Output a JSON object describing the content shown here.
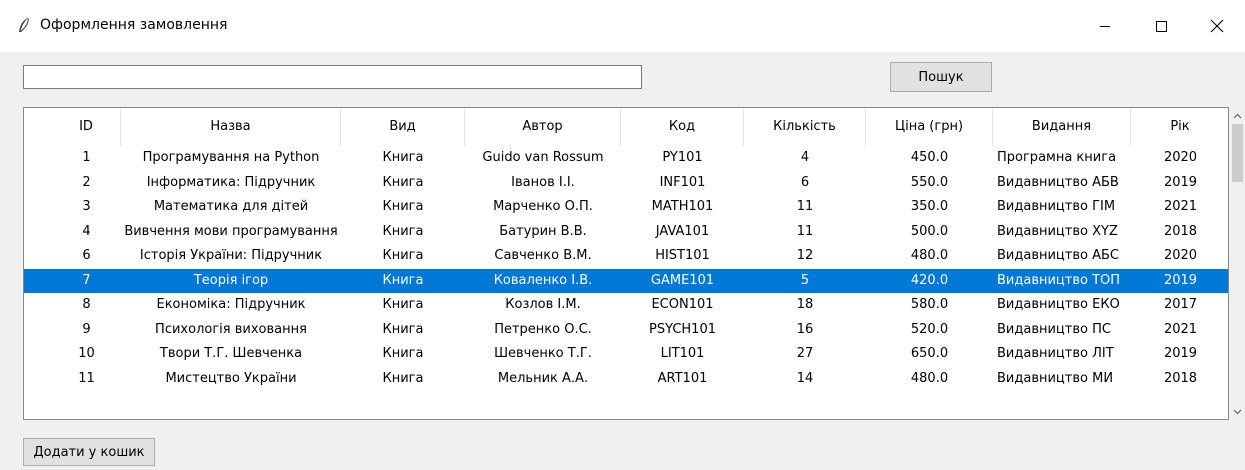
{
  "window": {
    "title": "Оформлення замовлення",
    "app_icon": "feather-icon",
    "controls": [
      "minimize-icon",
      "maximize-icon",
      "close-icon"
    ]
  },
  "search": {
    "value": "",
    "placeholder": "",
    "button_label": "Пошук"
  },
  "table": {
    "columns": [
      "ID",
      "Назва",
      "Вид",
      "Автор",
      "Код",
      "Кількість",
      "Ціна (грн)",
      "Видання",
      "Рік"
    ],
    "rows": [
      [
        "1",
        "Програмування на Python",
        "Книга",
        "Guido van Rossum",
        "PY101",
        "4",
        "450.0",
        "Програмна книга",
        "2020"
      ],
      [
        "2",
        "Інформатика: Підручник",
        "Книга",
        "Іванов І.І.",
        "INF101",
        "6",
        "550.0",
        "Видавництво АБВ",
        "2019"
      ],
      [
        "3",
        "Математика для дітей",
        "Книга",
        "Марченко О.П.",
        "MATH101",
        "11",
        "350.0",
        "Видавництво ГІМ",
        "2021"
      ],
      [
        "4",
        "Вивчення мови програмування",
        "Книга",
        "Батурин В.В.",
        "JAVA101",
        "11",
        "500.0",
        "Видавництво XYZ",
        "2018"
      ],
      [
        "6",
        "Історія України: Підручник",
        "Книга",
        "Савченко В.М.",
        "HIST101",
        "12",
        "480.0",
        "Видавництво АБС",
        "2020"
      ],
      [
        "7",
        "Теорія ігор",
        "Книга",
        "Коваленко І.В.",
        "GAME101",
        "5",
        "420.0",
        "Видавництво ТОП",
        "2019"
      ],
      [
        "8",
        "Економіка: Підручник",
        "Книга",
        "Козлов І.М.",
        "ECON101",
        "18",
        "580.0",
        "Видавництво ЕКО",
        "2017"
      ],
      [
        "9",
        "Психологія виховання",
        "Книга",
        "Петренко О.С.",
        "PSYCH101",
        "16",
        "520.0",
        "Видавництво ПС",
        "2021"
      ],
      [
        "10",
        "Твори Т.Г. Шевченка",
        "Книга",
        "Шевченко Т.Г.",
        "LIT101",
        "27",
        "650.0",
        "Видавництво ЛІТ",
        "2019"
      ],
      [
        "11",
        "Мистецтво України",
        "Книга",
        "Мельник А.А.",
        "ART101",
        "14",
        "480.0",
        "Видавництво МИ",
        "2018"
      ]
    ],
    "selected_row_index": 5
  },
  "scrollbar": {
    "up_icon": "chevron-up-icon",
    "down_icon": "chevron-down-icon"
  },
  "actions": {
    "add_to_cart_label": "Додати у кошик"
  },
  "colors": {
    "selection": "#0078d7",
    "titlebar": "#ffffff",
    "background": "#f0f0f0"
  }
}
